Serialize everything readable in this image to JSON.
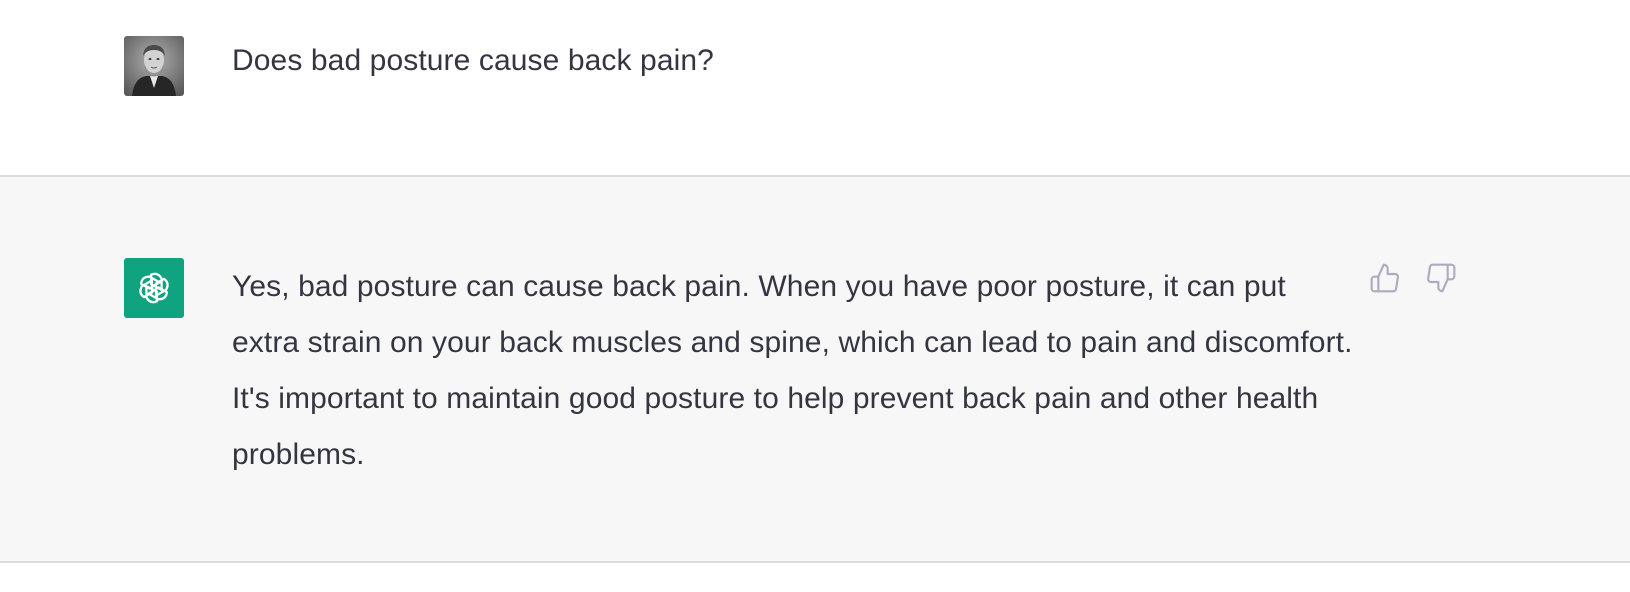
{
  "conversation": {
    "user_message": {
      "text": "Does bad posture cause back pain?",
      "avatar_icon": "user-portrait-avatar"
    },
    "assistant_message": {
      "text": "Yes, bad posture can cause back pain. When you have poor posture, it can put extra strain on your back muscles and spine, which can lead to pain and discomfort. It's important to maintain good posture to help prevent back pain and other health problems.",
      "avatar_icon": "openai-logo-icon",
      "avatar_color": "#10a37f"
    },
    "feedback": {
      "thumbs_up_icon": "thumbs-up-icon",
      "thumbs_down_icon": "thumbs-down-icon",
      "icon_color": "#acacbe"
    }
  },
  "colors": {
    "text": "#343541",
    "assistant_background": "#f7f7f8",
    "divider": "#dcdce0"
  }
}
